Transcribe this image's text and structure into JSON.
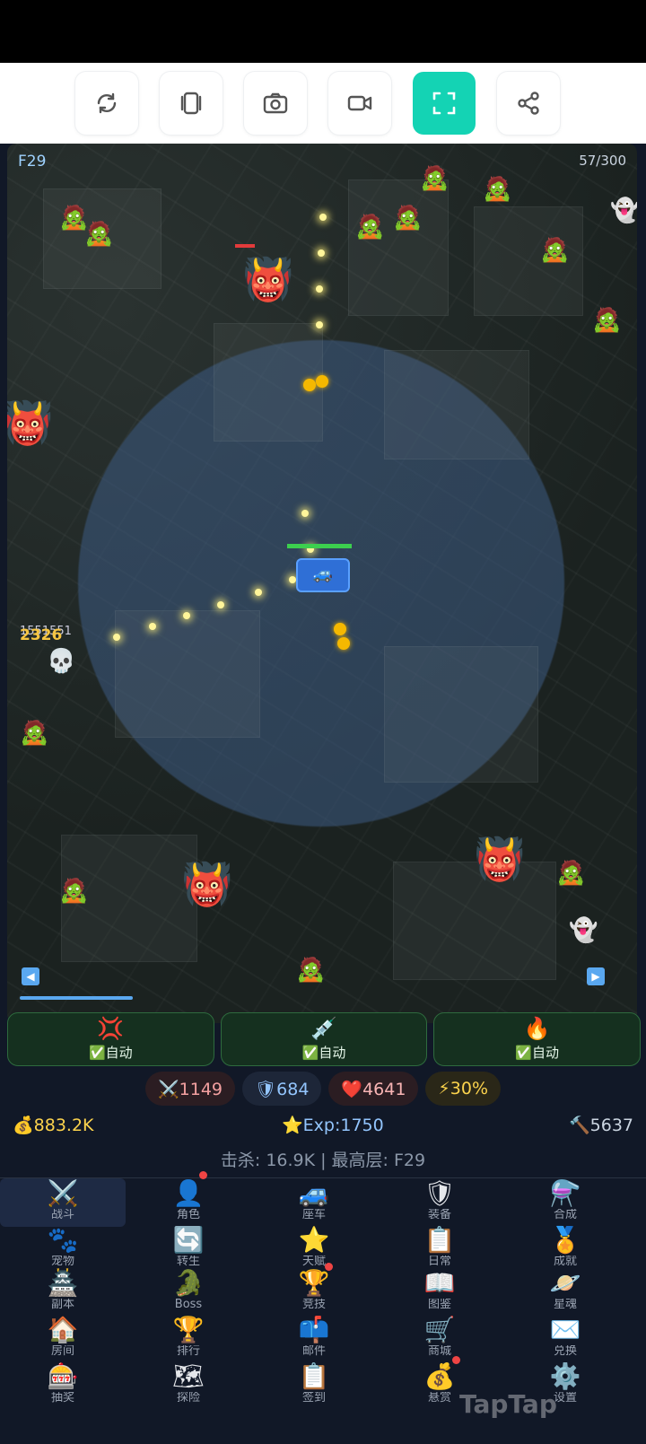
{
  "toolbar": {
    "buttons": [
      "rotate-icon",
      "layers-icon",
      "camera-icon",
      "video-icon",
      "fullscreen-icon",
      "share-icon"
    ],
    "active_color": "#14d3b4"
  },
  "map": {
    "floor": "F29",
    "kill_progress": "57/300",
    "damage_text": "2326",
    "damage_text_small": "1551551"
  },
  "skills": [
    {
      "icon": "💢",
      "auto_label": "✅自动"
    },
    {
      "icon": "💉",
      "auto_label": "✅自动"
    },
    {
      "icon": "🔥",
      "auto_label": "✅自动"
    }
  ],
  "stats": {
    "attack": "⚔️1149",
    "defense": "🛡684",
    "hp": "❤️4641",
    "crit": "⚡30%"
  },
  "resources": {
    "gold": "💰883.2K",
    "exp": "⭐Exp:1750",
    "power": "🔨5637"
  },
  "summary": "击杀: 16.9K  |  最高层: F29",
  "menu": [
    {
      "icon": "⚔️",
      "label": "战斗"
    },
    {
      "icon": "👤",
      "label": "角色"
    },
    {
      "icon": "🚙",
      "label": "座车"
    },
    {
      "icon": "🛡",
      "label": "装备"
    },
    {
      "icon": "⚗️",
      "label": "合成"
    },
    {
      "icon": "🐾",
      "label": "宠物"
    },
    {
      "icon": "🔄",
      "label": "转生"
    },
    {
      "icon": "⭐",
      "label": "天赋"
    },
    {
      "icon": "📋",
      "label": "日常"
    },
    {
      "icon": "🏅",
      "label": "成就"
    },
    {
      "icon": "🏯",
      "label": "副本"
    },
    {
      "icon": "🐊",
      "label": "Boss"
    },
    {
      "icon": "🏆",
      "label": "竞技"
    },
    {
      "icon": "📖",
      "label": "图鉴"
    },
    {
      "icon": "🪐",
      "label": "星魂"
    },
    {
      "icon": "🏠",
      "label": "房间"
    },
    {
      "icon": "🏆",
      "label": "排行"
    },
    {
      "icon": "📫",
      "label": "邮件"
    },
    {
      "icon": "🛒",
      "label": "商城"
    },
    {
      "icon": "✉️",
      "label": "兑换"
    },
    {
      "icon": "🎰",
      "label": "抽奖"
    },
    {
      "icon": "🗺",
      "label": "探险"
    },
    {
      "icon": "📋",
      "label": "签到"
    },
    {
      "icon": "💰",
      "label": "悬赏"
    },
    {
      "icon": "⚙️",
      "label": "设置"
    }
  ],
  "watermark": "TapTap"
}
